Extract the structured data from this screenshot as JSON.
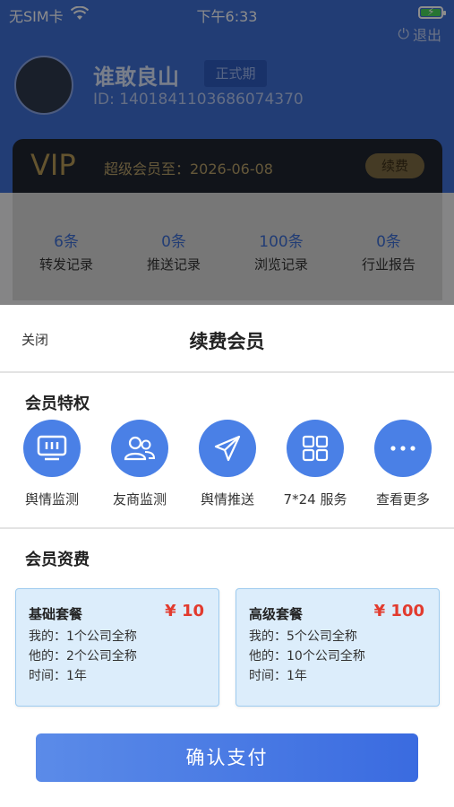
{
  "status_bar": {
    "carrier": "无SIM卡",
    "time": "下午6:33"
  },
  "profile": {
    "logout": "退出",
    "name": "谁敢良山",
    "badge": "正式期",
    "id": "ID: 14018411036860743​70"
  },
  "vip": {
    "label": "VIP",
    "until": "超级会员至：2026-06-08",
    "renew": "续费"
  },
  "stats": [
    {
      "num": "6条",
      "label": "转发记录"
    },
    {
      "num": "0条",
      "label": "推送记录"
    },
    {
      "num": "100条",
      "label": "浏览记录"
    },
    {
      "num": "0条",
      "label": "行业报告"
    }
  ],
  "sheet": {
    "close": "关闭",
    "title": "续费会员",
    "privileges_title": "会员特权",
    "privileges": [
      {
        "label": "舆情监测",
        "icon": "monitor-icon"
      },
      {
        "label": "友商监测",
        "icon": "users-icon"
      },
      {
        "label": "舆情推送",
        "icon": "send-icon"
      },
      {
        "label": "7*24 服务",
        "icon": "grid-icon"
      },
      {
        "label": "查看更多",
        "icon": "more-icon"
      }
    ],
    "fees_title": "会员资费",
    "plans": [
      {
        "name": "基础套餐",
        "price": "¥ 10",
        "mine": "我的：1个公司全称",
        "others": "他的：2个公司全称",
        "time": "时间：1年"
      },
      {
        "name": "高级套餐",
        "price": "¥ 100",
        "mine": "我的：5个公司全称",
        "others": "他的：10个公司全称",
        "time": "时间：1年"
      }
    ],
    "confirm": "确认支付"
  },
  "colors": {
    "accent": "#4a80e6",
    "price": "#e23b2e",
    "plan_bg": "#dcedfb"
  }
}
